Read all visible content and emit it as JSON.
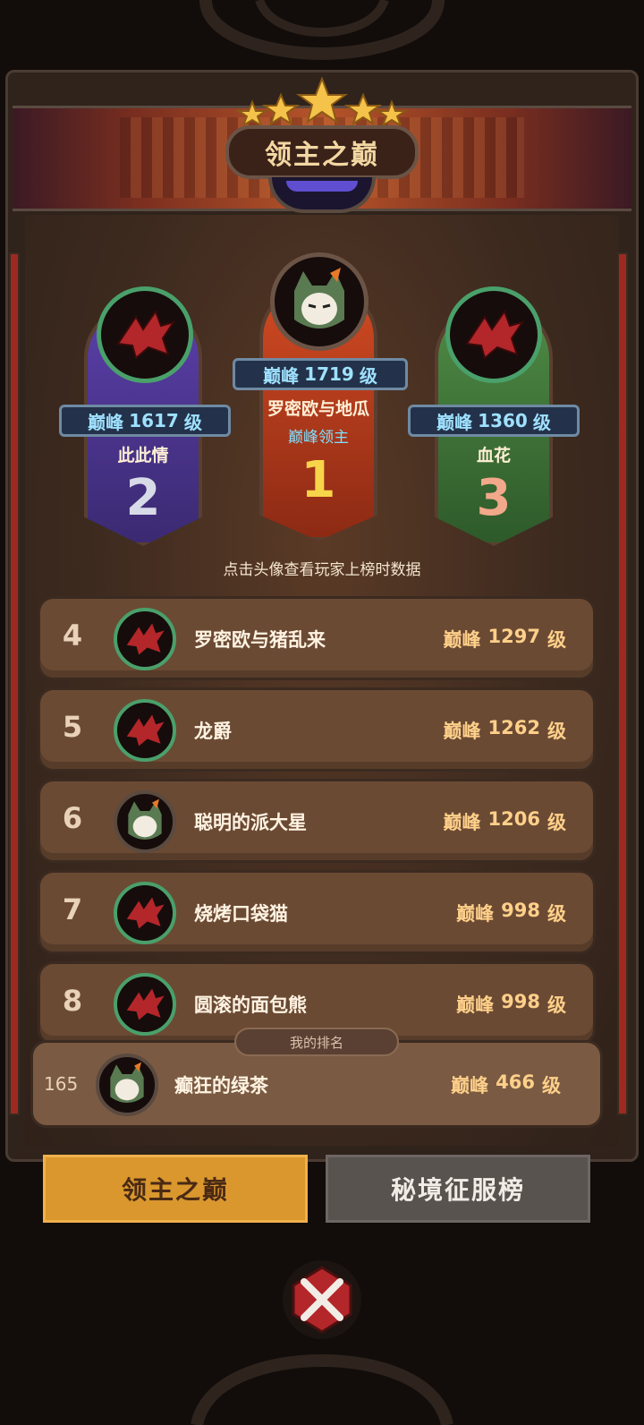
{
  "header": {
    "title": "领主之巅"
  },
  "podium": [
    {
      "rank": "2",
      "level_prefix": "巅峰",
      "level": "1617",
      "level_suffix": "级",
      "name": "此此情",
      "avatar": "red-dragon-icon",
      "color": "#4a3392"
    },
    {
      "rank": "1",
      "level_prefix": "巅峰",
      "level": "1719",
      "level_suffix": "级",
      "name": "罗密欧与地瓜",
      "title": "巅峰领主",
      "avatar": "fox-hood-icon",
      "color": "#b53c1e"
    },
    {
      "rank": "3",
      "level_prefix": "巅峰",
      "level": "1360",
      "level_suffix": "级",
      "name": "血花",
      "avatar": "red-dragon-icon",
      "color": "#3c6a35"
    }
  ],
  "hint": "点击头像查看玩家上榜时数据",
  "list": [
    {
      "rank": "4",
      "name": "罗密欧与猪乱来",
      "level_prefix": "巅峰",
      "level": "1297",
      "level_suffix": "级",
      "avatar": "red-dragon-icon"
    },
    {
      "rank": "5",
      "name": "龙爵",
      "level_prefix": "巅峰",
      "level": "1262",
      "level_suffix": "级",
      "avatar": "red-dragon-icon"
    },
    {
      "rank": "6",
      "name": "聪明的派大星",
      "level_prefix": "巅峰",
      "level": "1206",
      "level_suffix": "级",
      "avatar": "fox-hood-icon"
    },
    {
      "rank": "7",
      "name": "烧烤口袋猫",
      "level_prefix": "巅峰",
      "level": "998",
      "level_suffix": "级",
      "avatar": "red-dragon-icon"
    },
    {
      "rank": "8",
      "name": "圆滚的面包熊",
      "level_prefix": "巅峰",
      "level": "998",
      "level_suffix": "级",
      "avatar": "red-dragon-icon"
    }
  ],
  "my_rank": {
    "label": "我的排名",
    "rank": "165",
    "name": "癫狂的绿茶",
    "level_prefix": "巅峰",
    "level": "466",
    "level_suffix": "级",
    "avatar": "fox-hood-icon"
  },
  "tabs": [
    {
      "label": "领主之巅",
      "active": true
    },
    {
      "label": "秘境征服榜",
      "active": false
    }
  ],
  "close_icon": "crossed-swords-close-icon"
}
